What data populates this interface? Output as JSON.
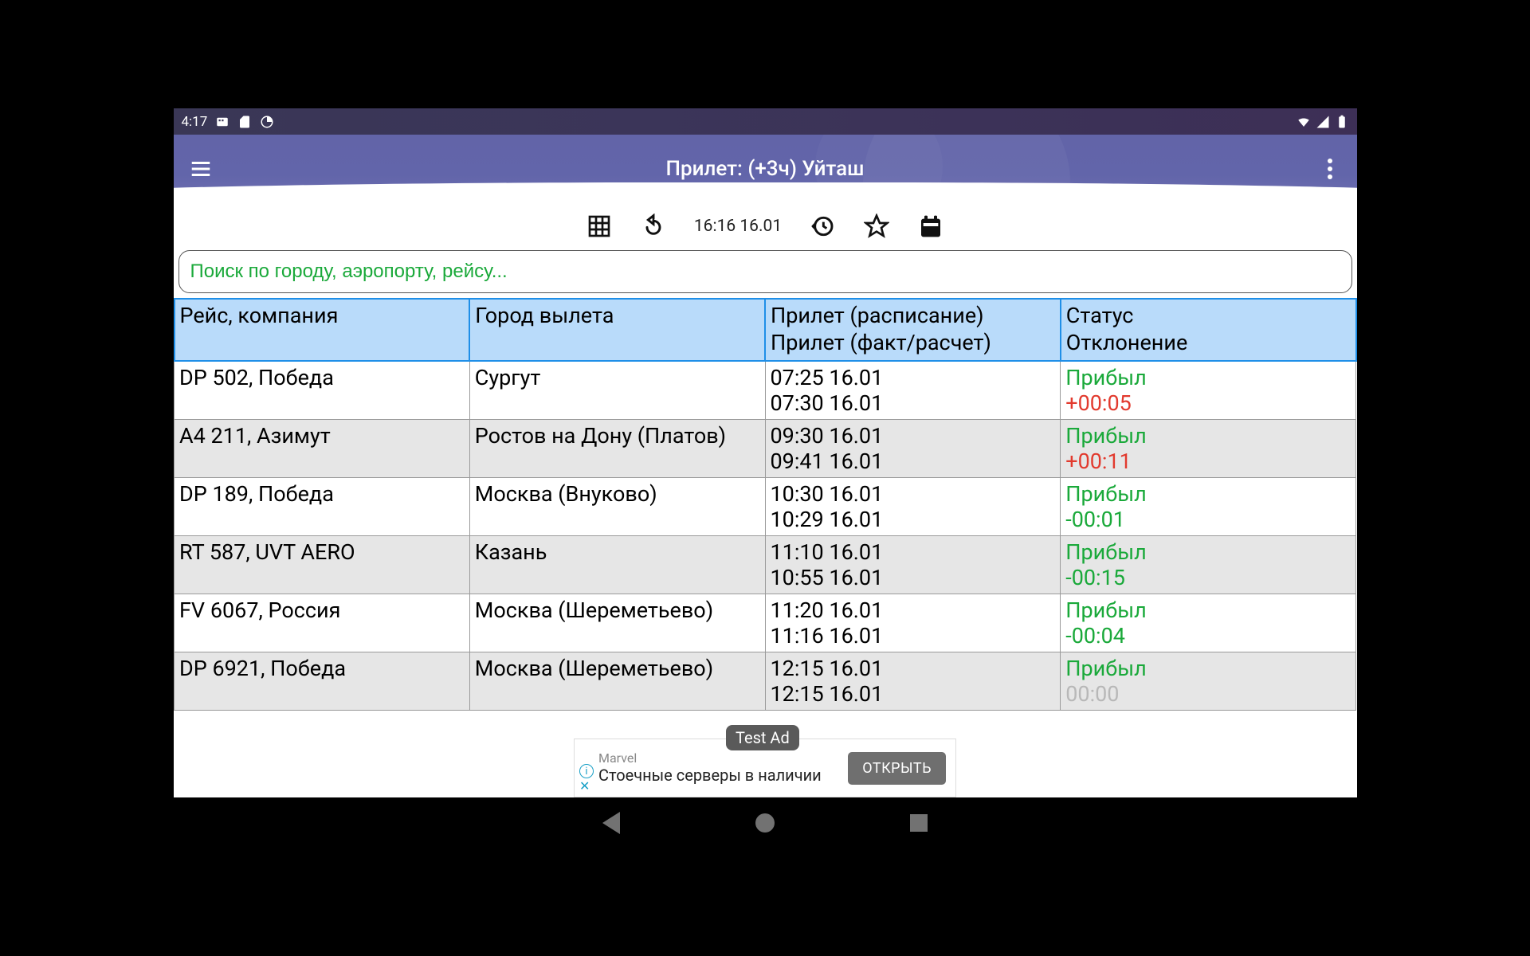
{
  "statusbar": {
    "time": "4:17"
  },
  "appbar": {
    "title": "Прилет: (+3ч) Уйташ"
  },
  "toolrow": {
    "refresh_time": "16:16 16.01"
  },
  "search": {
    "placeholder": "Поиск по городу, аэропорту, рейсу..."
  },
  "table": {
    "headers": {
      "flight": "Рейс, компания",
      "city": "Город вылета",
      "time1": "Прилет (расписание)",
      "time2": "Прилет (факт/расчет)",
      "status": "Статус",
      "deviation": "Отклонение"
    },
    "rows": [
      {
        "flight": "DP 502, Победа",
        "city": "Сургут",
        "sched": "07:25 16.01",
        "fact": "07:30 16.01",
        "status": "Прибыл",
        "dev": "+00:05",
        "dev_cls": "dev-pos"
      },
      {
        "flight": "A4 211, Азимут",
        "city": "Ростов на Дону (Платов)",
        "sched": "09:30 16.01",
        "fact": "09:41 16.01",
        "status": "Прибыл",
        "dev": "+00:11",
        "dev_cls": "dev-pos"
      },
      {
        "flight": "DP 189, Победа",
        "city": "Москва (Внуково)",
        "sched": "10:30 16.01",
        "fact": "10:29 16.01",
        "status": "Прибыл",
        "dev": "-00:01",
        "dev_cls": "dev-neg"
      },
      {
        "flight": "RT 587, UVT AERO",
        "city": "Казань",
        "sched": "11:10 16.01",
        "fact": "10:55 16.01",
        "status": "Прибыл",
        "dev": "-00:15",
        "dev_cls": "dev-neg"
      },
      {
        "flight": "FV 6067, Россия",
        "city": "Москва (Шереметьево)",
        "sched": "11:20 16.01",
        "fact": "11:16 16.01",
        "status": "Прибыл",
        "dev": "-00:04",
        "dev_cls": "dev-neg"
      },
      {
        "flight": "DP 6921, Победа",
        "city": "Москва (Шереметьево)",
        "sched": "12:15 16.01",
        "fact": "12:15 16.01",
        "status": "Прибыл",
        "dev": "00:00",
        "dev_cls": "dev-zero"
      }
    ]
  },
  "ad": {
    "badge": "Test Ad",
    "brand": "Marvel",
    "line": "Стоечные серверы в наличии",
    "button": "ОТКРЫТЬ"
  }
}
